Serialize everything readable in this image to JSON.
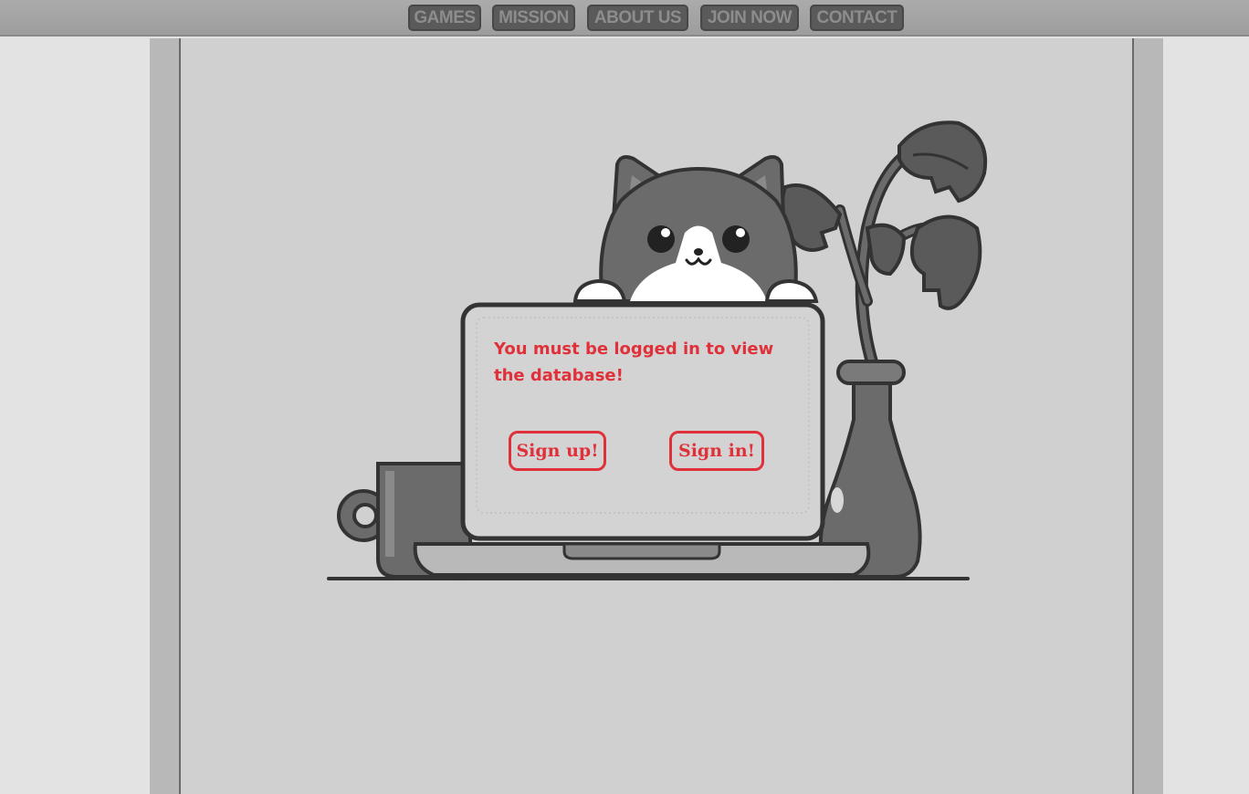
{
  "nav": {
    "items": [
      {
        "label": "GAMES"
      },
      {
        "label": "MISSION"
      },
      {
        "label": "ABOUT US"
      },
      {
        "label": "JOIN NOW"
      },
      {
        "label": "CONTACT"
      }
    ]
  },
  "main": {
    "message": "You must be logged in to view the database!",
    "signup_label": "Sign up!",
    "signin_label": "Sign in!"
  },
  "illustration": {
    "icon": "cat-with-laptop-icon"
  },
  "colors": {
    "accent": "#e0303a",
    "nav_button": "#5a5a5a",
    "nav_text": "#8d8d8d",
    "content_bg": "#d0d0d0"
  }
}
